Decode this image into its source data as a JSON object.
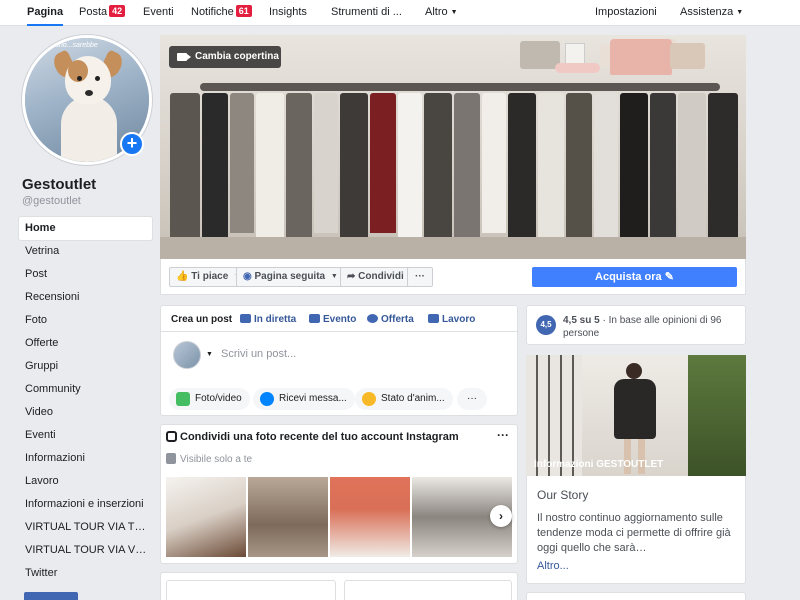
{
  "topnav": {
    "items": [
      {
        "label": "Pagina"
      },
      {
        "label": "Posta",
        "badge": "42"
      },
      {
        "label": "Eventi"
      },
      {
        "label": "Notifiche",
        "badge": "61"
      },
      {
        "label": "Insights"
      },
      {
        "label": "Strumenti di ..."
      },
      {
        "label": "Altro"
      },
      {
        "label": "Impostazioni"
      },
      {
        "label": "Assistenza"
      }
    ]
  },
  "profile": {
    "name": "Gestoutlet",
    "handle": "@gestoutlet",
    "avatar_caption": "territorio...sarebbe"
  },
  "sidebar": {
    "items": [
      {
        "label": "Home"
      },
      {
        "label": "Vetrina"
      },
      {
        "label": "Post"
      },
      {
        "label": "Recensioni"
      },
      {
        "label": "Foto"
      },
      {
        "label": "Offerte"
      },
      {
        "label": "Gruppi"
      },
      {
        "label": "Community"
      },
      {
        "label": "Video"
      },
      {
        "label": "Eventi"
      },
      {
        "label": "Informazioni"
      },
      {
        "label": "Lavoro"
      },
      {
        "label": "Informazioni e inserzioni"
      },
      {
        "label": "VIRTUAL TOUR VIA TRE..."
      },
      {
        "label": "VIRTUAL TOUR VIA VERDI"
      },
      {
        "label": "Twitter"
      }
    ]
  },
  "cover": {
    "change_label": "Cambia copertina"
  },
  "actions": {
    "like": "Ti piace",
    "follow": "Pagina seguita",
    "share": "Condividi",
    "more": "···",
    "buy": "Acquista ora"
  },
  "composer": {
    "tabs": [
      "Crea un post",
      "In diretta",
      "Evento",
      "Offerta",
      "Lavoro"
    ],
    "placeholder": "Scrivi un post...",
    "pills": [
      "Foto/video",
      "Ricevi messa...",
      "Stato d'anim...",
      "···"
    ]
  },
  "instagram": {
    "title": "Condividi una foto recente del tuo account Instagram",
    "visibility": "Visibile solo a te"
  },
  "rating": {
    "score": "4,5",
    "text_bold": "4,5 su 5",
    "text_rest": " · In base alle opinioni di 96 persone"
  },
  "info": {
    "caption": "Informazioni GESTOUTLET",
    "story_title": "Our Story",
    "story_text": "Il nostro continuo aggiornamento sulle tendenze moda ci permette di offrire già oggi quello che sarà…",
    "more": "Altro..."
  }
}
